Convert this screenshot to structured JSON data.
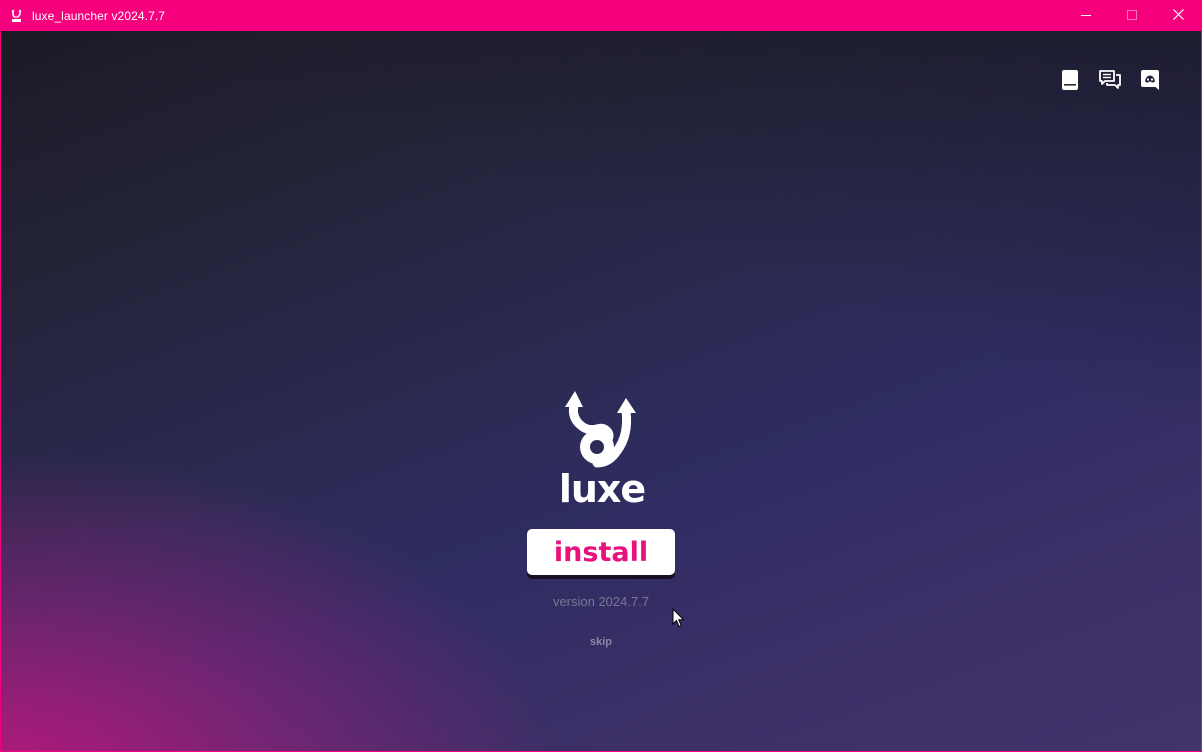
{
  "window": {
    "title": "luxe_launcher v2024.7.7",
    "accent_color": "#f7007d"
  },
  "window_controls": {
    "minimize_icon": "minimize-icon",
    "maximize_icon": "maximize-icon",
    "close_icon": "close-icon"
  },
  "toolbar": {
    "icons": [
      "book-icon",
      "chat-icon",
      "discord-icon"
    ]
  },
  "main": {
    "logo_icon": "luxe-logo-icon",
    "wordmark": "luxe",
    "install_label": "install",
    "install_color": "#e8117e",
    "version_text": "version 2024.7.7",
    "skip_label": "skip"
  }
}
